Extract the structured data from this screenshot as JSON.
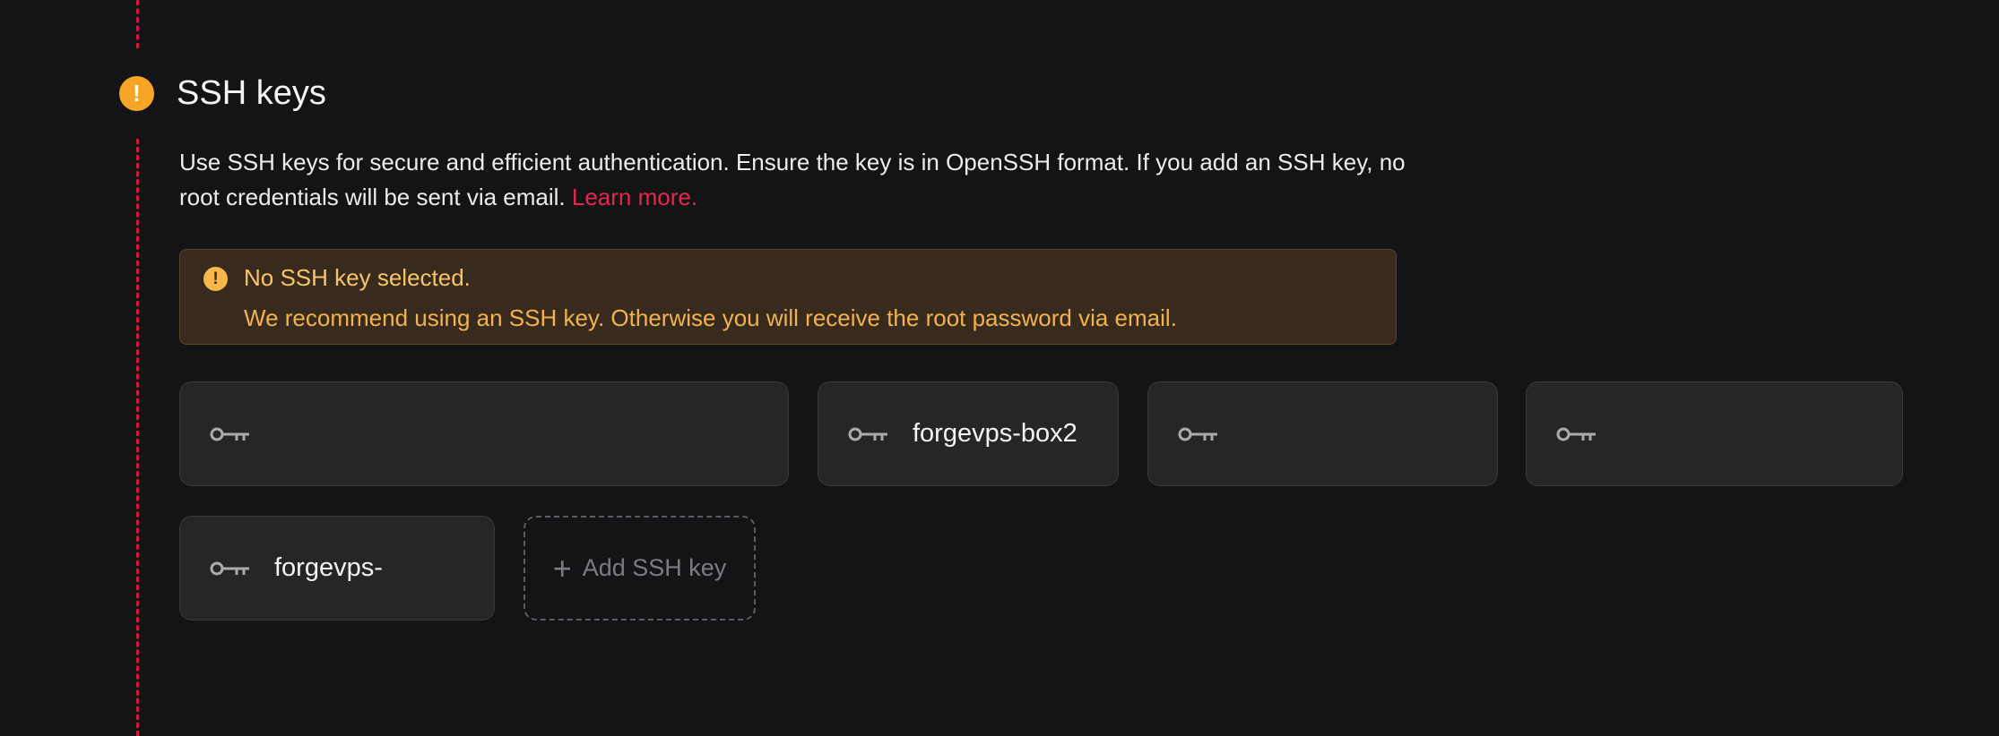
{
  "section": {
    "title": "SSH keys",
    "step_icon": "exclamation-icon",
    "description": "Use SSH keys for secure and efficient authentication. Ensure the key is in OpenSSH format. If you add an SSH key, no root credentials will be sent via email.",
    "learn_more": "Learn more."
  },
  "alert": {
    "icon": "exclamation-icon",
    "title": "No SSH key selected.",
    "message": "We recommend using an SSH key. Otherwise you will receive the root password via email."
  },
  "ssh_keys": [
    {
      "label": "",
      "icon": "key-icon"
    },
    {
      "label": "forgevps-box2",
      "icon": "key-icon"
    },
    {
      "label": "",
      "icon": "key-icon"
    },
    {
      "label": "",
      "icon": "key-icon"
    },
    {
      "label": "forgevps-",
      "icon": "key-icon"
    }
  ],
  "add_key": {
    "label": "Add SSH key",
    "icon": "plus-icon"
  },
  "colors": {
    "background": "#131415",
    "accent": "#e8264d",
    "warning": "#f6a524",
    "alert_background": "#382b1d",
    "alert_text": "#f2b24f",
    "card_background": "#252627"
  }
}
